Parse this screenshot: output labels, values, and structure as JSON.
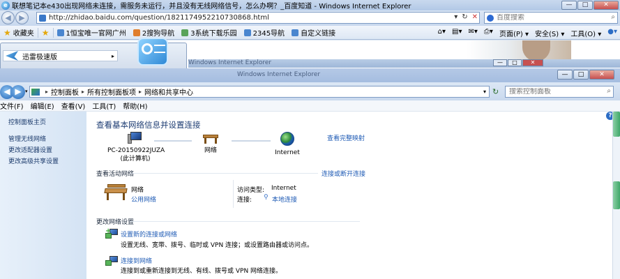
{
  "ie": {
    "title": "联想笔记本e430出现网络未连接，需服务未运行，并且没有无线网络信号，怎么办啊？_百度知道 - Windows Internet Explorer",
    "url": "http://zhidao.baidu.com/question/1821174952210730868.html",
    "search_placeholder": "百度搜索",
    "favorites_label": "收藏夹",
    "fav_links": [
      "1恒宝唯一官网广州",
      "2搜狗导航",
      "3系统下载乐园",
      "2345导航",
      "自定义链接"
    ],
    "toolbar_right": [
      "页面(P)",
      "安全(S)",
      "工具(O)"
    ],
    "win_min": "—",
    "win_max": "□",
    "win_close": "✕"
  },
  "popup": {
    "item_label": "迅雷极速版",
    "arrow": "▸"
  },
  "back_window": {
    "title": "Windows Internet Explorer"
  },
  "control_panel": {
    "breadcrumb": [
      "控制面板",
      "所有控制面板项",
      "网络和共享中心"
    ],
    "search_placeholder": "搜索控制面板",
    "menu": [
      "文件(F)",
      "编辑(E)",
      "查看(V)",
      "工具(T)",
      "帮助(H)"
    ],
    "left_links": [
      "控制面板主页",
      "管理无线网络",
      "更改适配器设置",
      "更改高级共享设置"
    ],
    "heading": "查看基本网络信息并设置连接",
    "view_full_map": "查看完整映射",
    "map": {
      "pc_name": "PC-20150922JUZA",
      "pc_sub": "(此计算机)",
      "network": "网络",
      "internet": "Internet"
    },
    "active_section_title": "查看活动网络",
    "connect_or_disconnect": "连接或断开连接",
    "active_network": {
      "name": "网络",
      "type": "公用网络",
      "access_label": "访问类型:",
      "access_value": "Internet",
      "conn_label": "连接:",
      "conn_value": "本地连接"
    },
    "change_section_title": "更改网络设置",
    "tasks": [
      {
        "title": "设置新的连接或网络",
        "desc": "设置无线、宽带、拨号、临时或 VPN 连接；或设置路由器或访问点。"
      },
      {
        "title": "连接到网络",
        "desc": "连接到或重新连接到无线、有线、拨号或 VPN 网络连接。"
      }
    ]
  }
}
